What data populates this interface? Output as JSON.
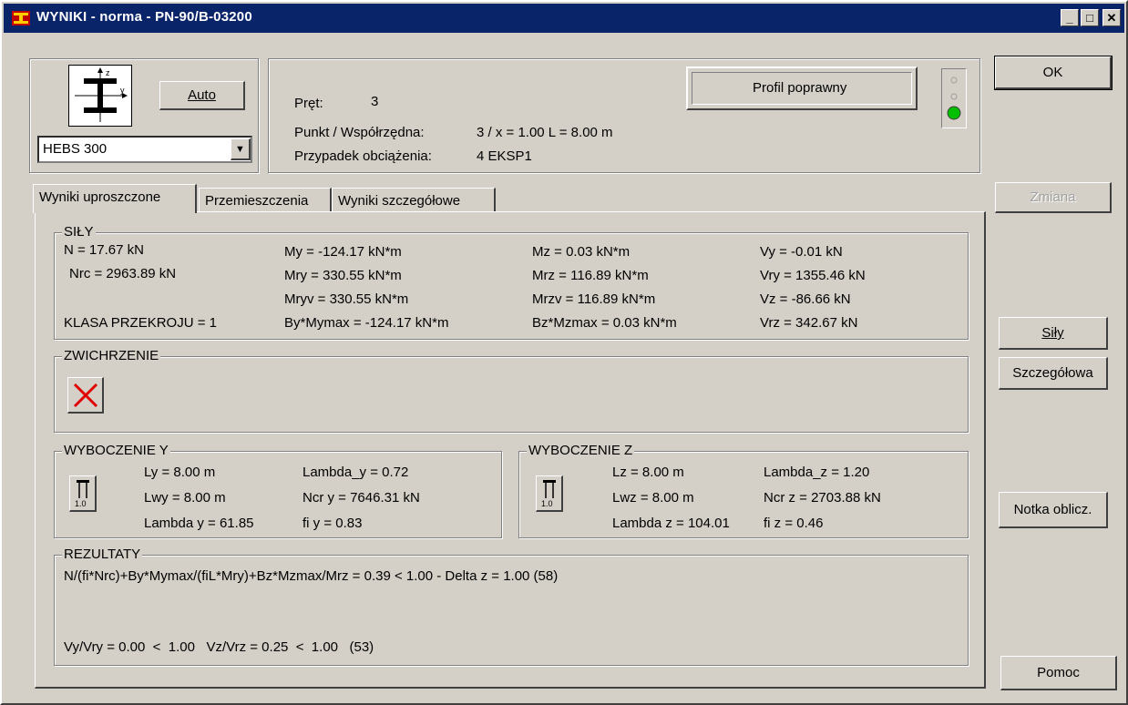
{
  "window": {
    "title": "WYNIKI - norma - PN-90/B-03200",
    "minimize_glyph": "_",
    "maximize_glyph": "□",
    "close_glyph": "✕"
  },
  "profile": {
    "auto_button": "Auto",
    "selected": "HEBS 300",
    "dropdown_glyph": "▼",
    "axis_y": "y",
    "axis_z": "z"
  },
  "info": {
    "pret_label": "Pręt:",
    "pret_value": "3",
    "punkt_label": "Punkt / Współrzędna:",
    "punkt_value": "3 / x = 1.00 L = 8.00 m",
    "przypadek_label": "Przypadek obciążenia:",
    "przypadek_value": "4 EKSP1",
    "status": "Profil poprawny",
    "status_light_color": "#00c000"
  },
  "buttons": {
    "ok": "OK",
    "zmiana": "Zmiana",
    "sily": "Siły",
    "szczegolowa": "Szczegółowa",
    "notka": "Notka oblicz.",
    "pomoc": "Pomoc"
  },
  "tabs": [
    {
      "label": "Wyniki uproszczone",
      "active": true
    },
    {
      "label": "Przemieszczenia",
      "active": false
    },
    {
      "label": "Wyniki szczegółowe",
      "active": false
    }
  ],
  "sily": {
    "title": "SIŁY",
    "n": "N = 17.67 kN",
    "nrc": "Nrc = 2963.89 kN",
    "klasa": "KLASA PRZEKROJU = 1",
    "my": "My = -124.17 kN*m",
    "mry": "Mry = 330.55 kN*m",
    "mryv": "Mryv = 330.55 kN*m",
    "by": "By*Mymax = -124.17 kN*m",
    "mz": "Mz = 0.03 kN*m",
    "mrz": "Mrz = 116.89 kN*m",
    "mrzv": "Mrzv = 116.89 kN*m",
    "bz": "Bz*Mzmax = 0.03 kN*m",
    "vy": "Vy = -0.01 kN",
    "vry": "Vry = 1355.46 kN",
    "vz": "Vz = -86.66 kN",
    "vrz": "Vrz = 342.67 kN"
  },
  "zwichrzenie": {
    "title": "ZWICHRZENIE"
  },
  "wyboczenie_y": {
    "title": "WYBOCZENIE Y",
    "icon_value": "1.0",
    "ly": "Ly = 8.00 m",
    "lwy": "Lwy = 8.00 m",
    "lambda_y": "Lambda y = 61.85",
    "lambda_y2": "Lambda_y = 0.72",
    "ncr_y": "Ncr y = 7646.31 kN",
    "fi_y": "fi y = 0.83"
  },
  "wyboczenie_z": {
    "title": "WYBOCZENIE Z",
    "icon_value": "1.0",
    "lz": "Lz = 8.00 m",
    "lwz": "Lwz = 8.00 m",
    "lambda_z": "Lambda z = 104.01",
    "lambda_z2": "Lambda_z = 1.20",
    "ncr_z": "Ncr z = 2703.88 kN",
    "fi_z": "fi z = 0.46"
  },
  "rezultaty": {
    "title": "REZULTATY",
    "line1": "N/(fi*Nrc)+By*Mymax/(fiL*Mry)+Bz*Mzmax/Mrz = 0.39 < 1.00 - Delta z = 1.00 (58)",
    "line2": "Vy/Vry = 0.00  <  1.00   Vz/Vrz = 0.25  <  1.00   (53)"
  }
}
